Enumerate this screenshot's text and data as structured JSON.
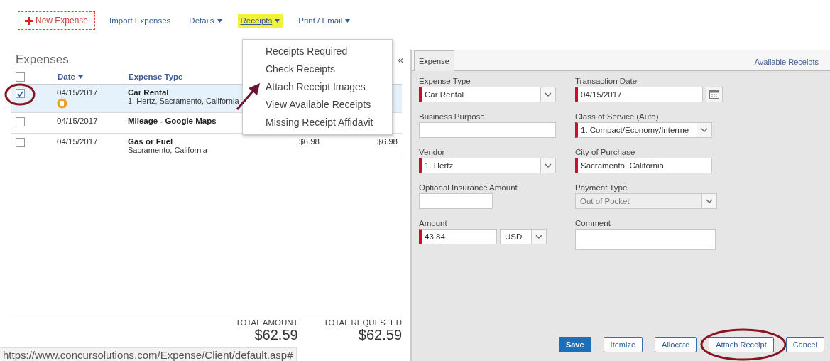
{
  "toolbar": [
    {
      "label": "New Expense",
      "kind": "new",
      "highlighted": false
    },
    {
      "label": "Import Expenses",
      "kind": "link",
      "highlighted": false
    },
    {
      "label": "Details",
      "kind": "menu",
      "highlighted": false
    },
    {
      "label": "Receipts",
      "kind": "menu",
      "highlighted": true
    },
    {
      "label": "Print / Email",
      "kind": "menu",
      "highlighted": false
    }
  ],
  "receipts_menu": [
    {
      "label": "Receipts Required",
      "pointed": false
    },
    {
      "label": "Check Receipts",
      "pointed": false
    },
    {
      "label": "Attach Receipt Images",
      "pointed": true
    },
    {
      "label": "View Available Receipts",
      "pointed": false
    },
    {
      "label": "Missing Receipt Affidavit",
      "pointed": false
    }
  ],
  "expenses": {
    "title": "Expenses",
    "collapse": "«",
    "all_checked": false,
    "columns": [
      {
        "label": "Date",
        "sorted": true
      },
      {
        "label": "Expense Type",
        "sorted": false
      }
    ],
    "rows": [
      {
        "checked": true,
        "selected": true,
        "circled": true,
        "flagged": true,
        "date": "04/15/2017",
        "type": "Car Rental",
        "detail": "1. Hertz, Sacramento, California"
      },
      {
        "checked": false,
        "selected": false,
        "circled": false,
        "flagged": false,
        "date": "04/15/2017",
        "type": "Mileage - Google Maps"
      },
      {
        "checked": false,
        "selected": false,
        "circled": false,
        "flagged": false,
        "date": "04/15/2017",
        "type": "Gas or Fuel",
        "detail": "Sacramento, California",
        "amount": "$6.98",
        "requested": "$6.98"
      }
    ],
    "totals": [
      {
        "label": "TOTAL AMOUNT",
        "value": "$62.59"
      },
      {
        "label": "TOTAL REQUESTED",
        "value": "$62.59"
      }
    ]
  },
  "form": {
    "tab": "Expense",
    "link": "Available Receipts",
    "fields": [
      {
        "label": "Expense Type",
        "kind": "select",
        "value": "Car Rental",
        "required": true,
        "disabled": false
      },
      {
        "label": "Transaction Date",
        "kind": "date",
        "value": "04/15/2017",
        "required": true,
        "disabled": false
      },
      {
        "label": "Business Purpose",
        "kind": "text",
        "required": false,
        "disabled": false
      },
      {
        "label": "Class of Service (Auto)",
        "kind": "select",
        "value": "1. Compact/Economy/Interme",
        "required": true,
        "disabled": false
      },
      {
        "label": "Vendor",
        "kind": "select",
        "value": "1. Hertz",
        "required": true,
        "disabled": false
      },
      {
        "label": "City of Purchase",
        "kind": "text",
        "value": "Sacramento, California",
        "required": true,
        "disabled": false
      },
      {
        "label": "Optional Insurance Amount",
        "kind": "text",
        "required": false,
        "disabled": false
      },
      {
        "label": "Payment Type",
        "kind": "select",
        "value": "Out of Pocket",
        "required": false,
        "disabled": true
      },
      {
        "label": "Amount",
        "kind": "amount",
        "value": "43.84",
        "currency": "USD",
        "required": true,
        "disabled": false
      },
      {
        "label": "Comment",
        "kind": "textarea",
        "required": false,
        "disabled": false
      }
    ],
    "buttons": [
      {
        "label": "Save",
        "kind": "primary",
        "circled": false
      },
      {
        "label": "Itemize",
        "kind": "default",
        "circled": false
      },
      {
        "label": "Allocate",
        "kind": "default",
        "circled": false
      },
      {
        "label": "Attach Receipt",
        "kind": "default",
        "circled": true
      },
      {
        "label": "Cancel",
        "kind": "default",
        "circled": false
      }
    ]
  },
  "status_url": "https://www.concursolutions.com/Expense/Client/default.asp#"
}
